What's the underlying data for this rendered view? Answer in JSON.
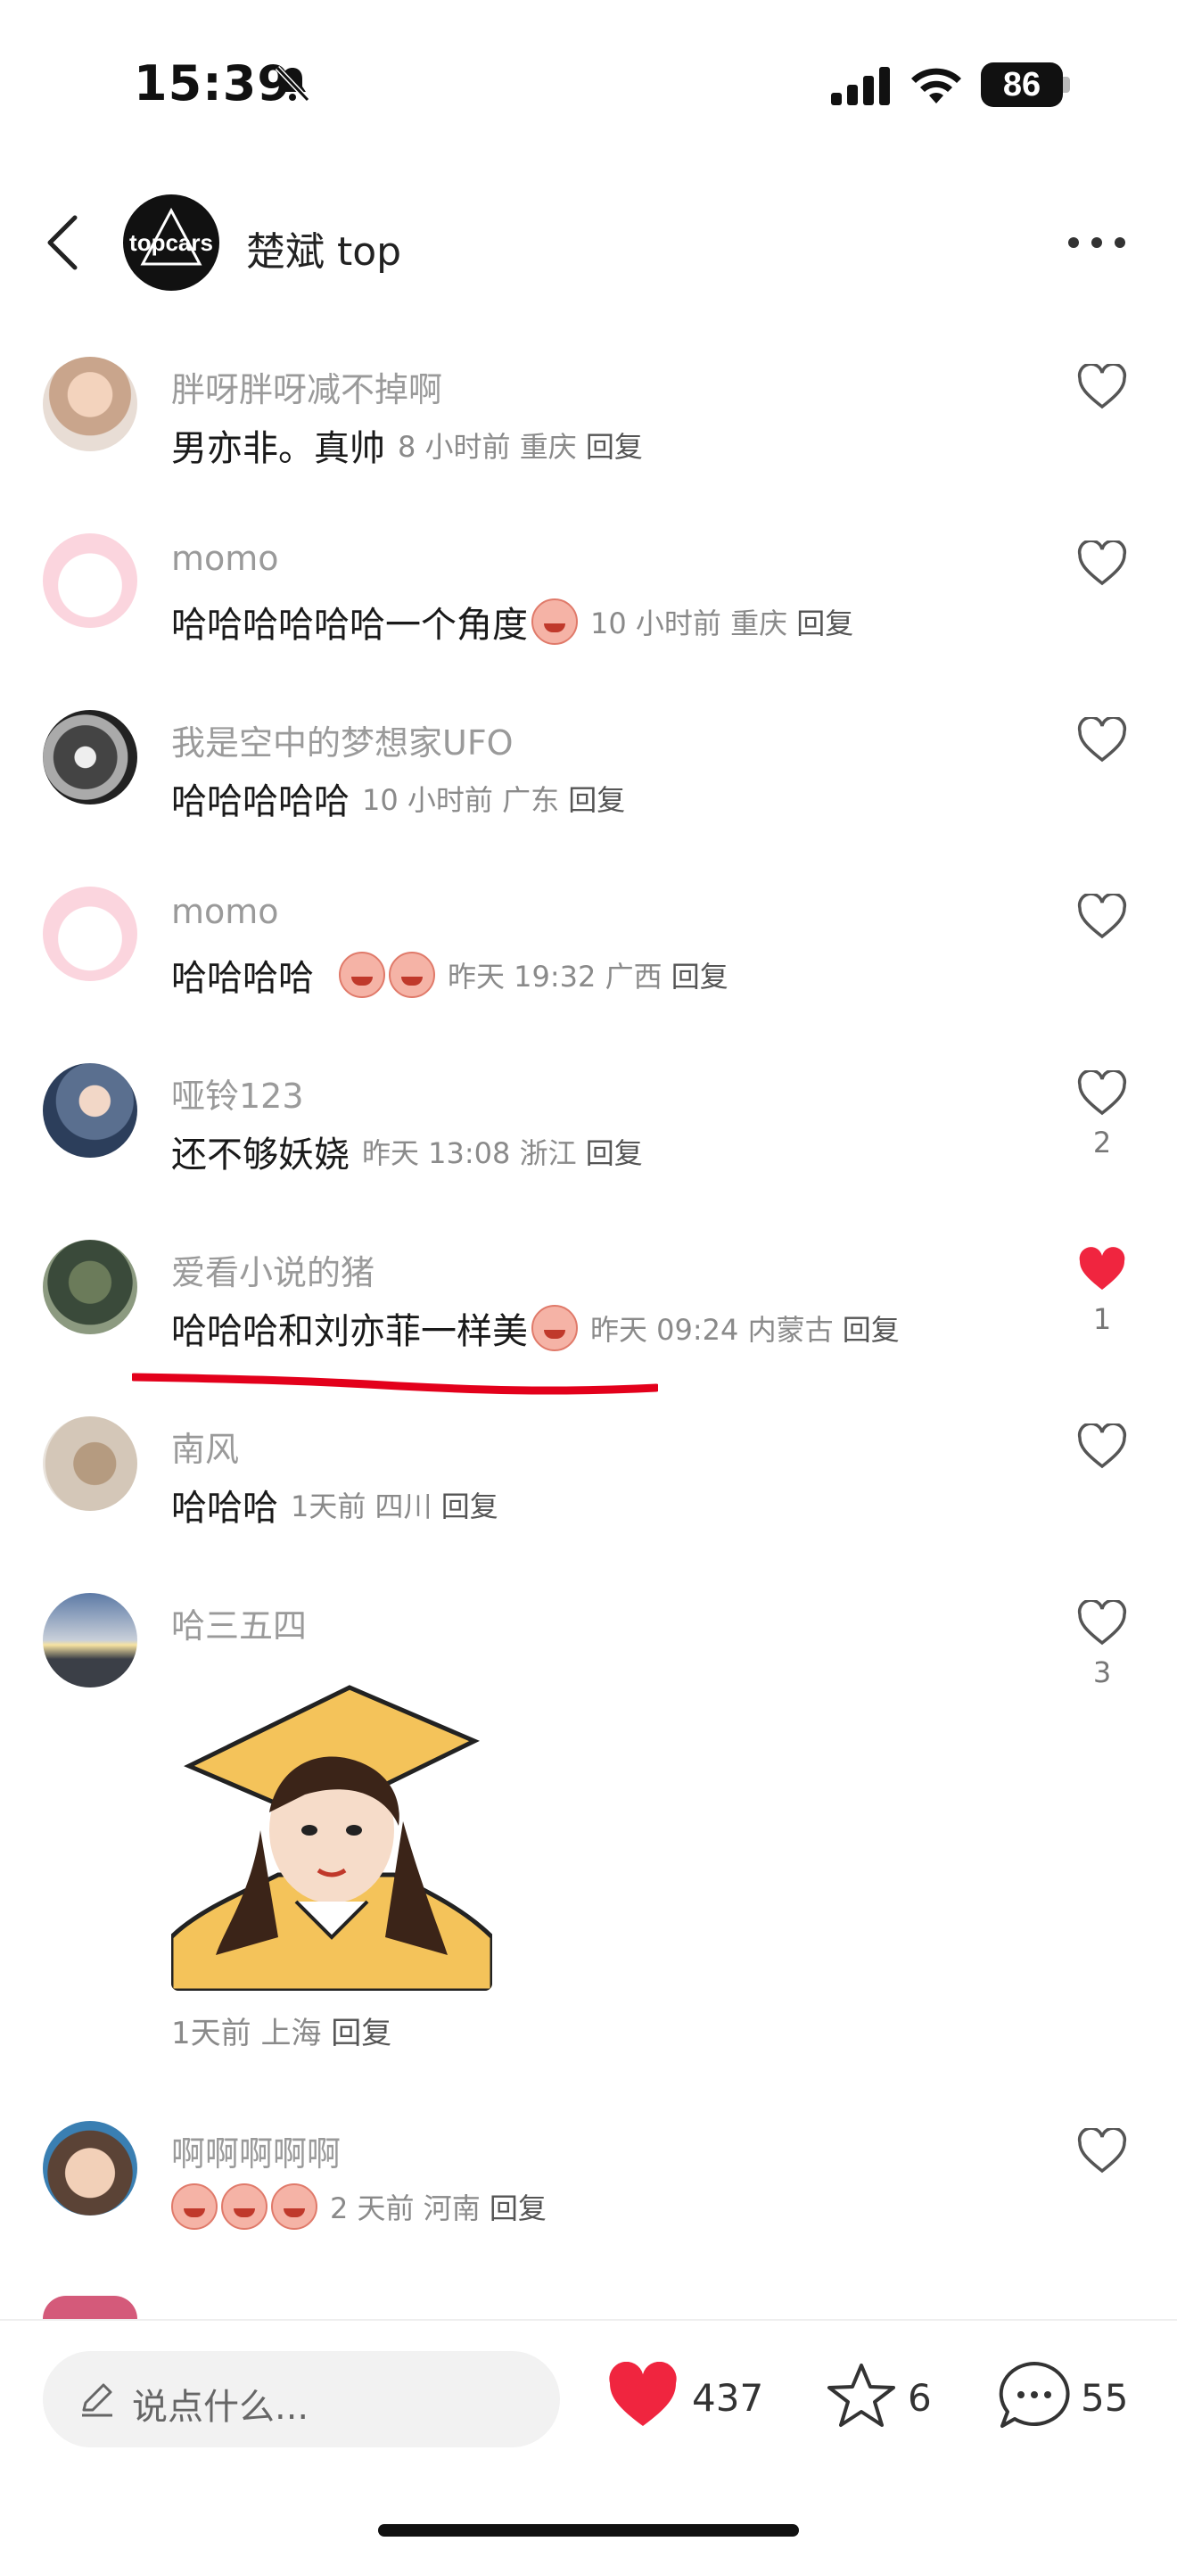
{
  "status_bar": {
    "time": "15:39",
    "battery": "86"
  },
  "header": {
    "logo_text": "topcars",
    "title": "楚斌 top"
  },
  "comments": [
    {
      "user": "胖呀胖呀减不掉啊",
      "text": "男亦非。真帅",
      "emojis": 0,
      "time": "8 小时前",
      "location": "重庆",
      "reply": "回复",
      "likes": ""
    },
    {
      "user": "momo",
      "text": "哈哈哈哈哈哈一个角度",
      "emojis": 1,
      "time": "10 小时前",
      "location": "重庆",
      "reply": "回复",
      "likes": ""
    },
    {
      "user": "我是空中的梦想家UFO",
      "text": "哈哈哈哈哈",
      "emojis": 0,
      "time": "10 小时前",
      "location": "广东",
      "reply": "回复",
      "likes": ""
    },
    {
      "user": "momo",
      "text": "哈哈哈哈",
      "emojis": 2,
      "time": "昨天 19:32",
      "location": "广西",
      "reply": "回复",
      "likes": ""
    },
    {
      "user": "哑铃123",
      "text": "还不够妖娆",
      "emojis": 0,
      "time": "昨天 13:08",
      "location": "浙江",
      "reply": "回复",
      "likes": "2"
    },
    {
      "user": "爱看小说的猪",
      "text": "哈哈哈和刘亦菲一样美",
      "emojis": 1,
      "time": "昨天 09:24",
      "location": "内蒙古",
      "reply": "回复",
      "likes": "1",
      "liked": true
    },
    {
      "user": "南风",
      "text": "哈哈哈",
      "emojis": 0,
      "time": "1天前",
      "location": "四川",
      "reply": "回复",
      "likes": ""
    },
    {
      "user": "哈三五四",
      "text": "",
      "emojis": 0,
      "time": "1天前",
      "location": "上海",
      "reply": "回复",
      "likes": "3"
    },
    {
      "user": "啊啊啊啊啊",
      "text": "",
      "emojis": 3,
      "time": "2 天前",
      "location": "河南",
      "reply": "回复",
      "likes": ""
    }
  ],
  "bottom_bar": {
    "placeholder": "说点什么...",
    "likes": "437",
    "stars": "6",
    "comments": "55"
  },
  "colors": {
    "accent_red": "#f0253f",
    "underline_red": "#e3001b"
  }
}
